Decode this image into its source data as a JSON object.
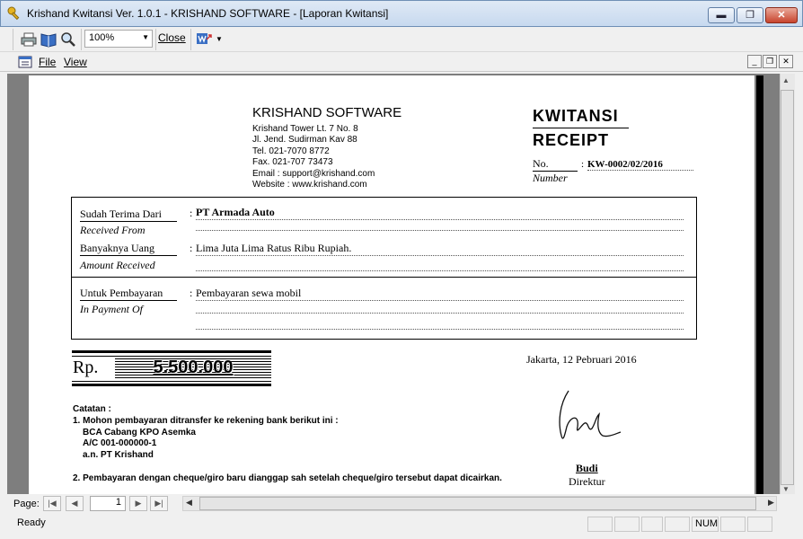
{
  "window": {
    "title": "Krishand Kwitansi Ver. 1.0.1 - KRISHAND SOFTWARE - [Laporan Kwitansi]",
    "buttons": [
      "▬",
      "❐",
      "✕"
    ]
  },
  "toolbar": {
    "zoom_value": "100%",
    "close_label": "Close"
  },
  "menu": {
    "items": [
      "File",
      "View"
    ]
  },
  "receipt": {
    "company": {
      "name": "KRISHAND SOFTWARE",
      "address1": "Krishand Tower Lt. 7 No. 8",
      "address2": "Jl. Jend. Sudirman Kav 88",
      "tel": "Tel.  021-7070 8772",
      "fax": "Fax. 021-707 73473",
      "email": "Email     :  support@krishand.com",
      "website": "Website :  www.krishand.com"
    },
    "title1": "KWITANSI",
    "title2": "RECEIPT",
    "no_label": "No.",
    "no_sub": "Number",
    "no_value": "KW-0002/02/2016",
    "fields": [
      {
        "label": "Sudah Terima Dari",
        "sub": "Received From",
        "value": "PT Armada Auto"
      },
      {
        "label": "Banyaknya Uang",
        "sub": "Amount Received",
        "value": "Lima Juta Lima Ratus  Ribu Rupiah."
      },
      {
        "label": "Untuk Pembayaran",
        "sub": "In Payment Of",
        "value": "Pembayaran sewa mobil"
      }
    ],
    "colon": ":",
    "rp_label": "Rp.",
    "amount": "5.500.000",
    "place_date": "Jakarta, 12 Pebruari 2016",
    "notes_title": "Catatan :",
    "notes": [
      "1. Mohon pembayaran ditransfer ke rekening bank berikut ini  :",
      "BCA Cabang KPO Asemka",
      "A/C 001-000000-1",
      "a.n. PT Krishand",
      "2. Pembayaran dengan cheque/giro baru dianggap sah setelah cheque/giro tersebut dapat dicairkan."
    ],
    "signer_name": "Budi",
    "signer_title": "Direktur"
  },
  "nav": {
    "page_label": "Page:",
    "page_value": "1"
  },
  "status": {
    "text": "Ready",
    "num": "NUM"
  }
}
